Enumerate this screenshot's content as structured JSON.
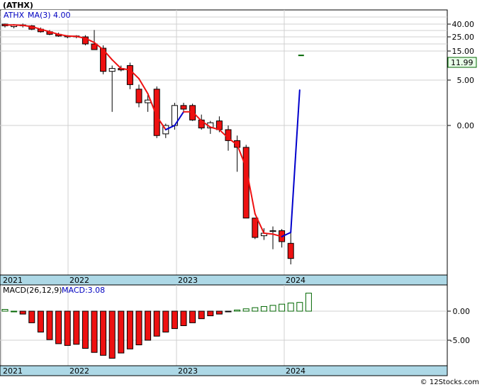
{
  "header": {
    "title": "(ATHX)"
  },
  "legend": {
    "symbol": "ATHX",
    "ma_label": "MA(3)",
    "ma_value": "4.00"
  },
  "macd_legend": {
    "label": "MACD(26,12,9)",
    "value": "MACD:3.08"
  },
  "footer": {
    "credit": "© 12Stocks.com"
  },
  "colors": {
    "down": "#ee1111",
    "up": "#ffffff",
    "ma_down": "#ee1111",
    "ma_up": "#0000cc",
    "axis_band": "#add8e6",
    "macd_pos_edge": "#006600",
    "grid": "#d0d0d0"
  },
  "chart_data": [
    {
      "type": "candlestick",
      "name_printed": "ATHX",
      "x_ticks": [
        "2021",
        "2022",
        "2023",
        "2024"
      ],
      "y_ticks": [
        "40.00",
        "25.00",
        "15.00",
        "5.00",
        "0.00"
      ],
      "last_price": "11.99",
      "moving_average": {
        "label": "MA(3)",
        "value": "4.00"
      },
      "candles": [
        {
          "o": 40,
          "h": 41,
          "l": 36,
          "c": 38
        },
        {
          "o": 37,
          "h": 40,
          "l": 35,
          "c": 39
        },
        {
          "o": 38,
          "h": 41,
          "l": 36,
          "c": 39
        },
        {
          "o": 38,
          "h": 39,
          "l": 33,
          "c": 34
        },
        {
          "o": 34,
          "h": 36,
          "l": 30,
          "c": 31
        },
        {
          "o": 31,
          "h": 33,
          "l": 27,
          "c": 28
        },
        {
          "o": 28,
          "h": 30,
          "l": 25,
          "c": 26
        },
        {
          "o": 25,
          "h": 27,
          "l": 24,
          "c": 26
        },
        {
          "o": 26,
          "h": 27,
          "l": 24,
          "c": 25
        },
        {
          "o": 25,
          "h": 27,
          "l": 19,
          "c": 20
        },
        {
          "o": 20,
          "h": 33,
          "l": 16,
          "c": 16
        },
        {
          "o": 17,
          "h": 19,
          "l": 7,
          "c": 8
        },
        {
          "o": 8,
          "h": 10,
          "l": 1.5,
          "c": 9
        },
        {
          "o": 9,
          "h": 10,
          "l": 8,
          "c": 8.5
        },
        {
          "o": 10,
          "h": 11,
          "l": 4,
          "c": 4.5
        },
        {
          "o": 4,
          "h": 4.5,
          "l": 2,
          "c": 2.5
        },
        {
          "o": 2.5,
          "h": 3.5,
          "l": 1.5,
          "c": 2.8
        },
        {
          "o": 4,
          "h": 4.3,
          "l": -1.5,
          "c": -1.2
        },
        {
          "o": -1,
          "h": 0.2,
          "l": -1.5,
          "c": 0
        },
        {
          "o": 0,
          "h": 2.5,
          "l": -0.5,
          "c": 2.2
        },
        {
          "o": 2.2,
          "h": 2.5,
          "l": 1.5,
          "c": 1.8
        },
        {
          "o": 2.2,
          "h": 2.4,
          "l": 0.5,
          "c": 0.6
        },
        {
          "o": 0.6,
          "h": 1.2,
          "l": -0.5,
          "c": -0.3
        },
        {
          "o": -0.3,
          "h": 0.5,
          "l": -1,
          "c": 0.3
        },
        {
          "o": 0.5,
          "h": 1,
          "l": -0.8,
          "c": -0.5
        },
        {
          "o": -0.5,
          "h": 0,
          "l": -3,
          "c": -1.8
        },
        {
          "o": -1.8,
          "h": -1.2,
          "l": -5.5,
          "c": -2.6
        },
        {
          "o": -2.6,
          "h": -2.3,
          "l": -5.5,
          "c": -11
        },
        {
          "o": -11,
          "h": -12,
          "l": -13.5,
          "c": -13.3
        },
        {
          "o": -13.1,
          "h": -12.2,
          "l": -13.6,
          "c": -12.8
        },
        {
          "o": -12.6,
          "h": -12,
          "l": -14.7,
          "c": -12.5
        },
        {
          "o": -12.5,
          "h": -12.3,
          "l": -14.5,
          "c": -13.8
        },
        {
          "o": -14,
          "h": -12.5,
          "l": -16.5,
          "c": -15.8
        }
      ],
      "post_spike_tick": 13.5,
      "ma_values": [
        39,
        39,
        38.5,
        37,
        34,
        31,
        28,
        26,
        25.5,
        24,
        21,
        16,
        12,
        9,
        8.5,
        5.5,
        3.5,
        1,
        -0.5,
        0,
        1.5,
        1.5,
        0.5,
        -0.2,
        -0.5,
        -1.5,
        -2.3,
        -5,
        -10.5,
        -12.8,
        -12.9,
        -13.2,
        -12.7,
        3.9
      ]
    },
    {
      "type": "bar",
      "name_printed": "MACD(26,12,9)",
      "y_ticks": [
        "0.00",
        "-5.00"
      ],
      "values": [
        0.3,
        0,
        -0.5,
        -2.0,
        -3.6,
        -4.9,
        -5.6,
        -5.9,
        -5.7,
        -6.4,
        -7.1,
        -7.6,
        -8.1,
        -7.2,
        -6.5,
        -5.8,
        -5.0,
        -4.3,
        -3.6,
        -3.0,
        -2.5,
        -2.0,
        -1.3,
        -0.8,
        -0.5,
        -0.1,
        0.2,
        0.4,
        0.6,
        0.8,
        1.0,
        1.2,
        1.4,
        1.5,
        3.1
      ]
    }
  ]
}
